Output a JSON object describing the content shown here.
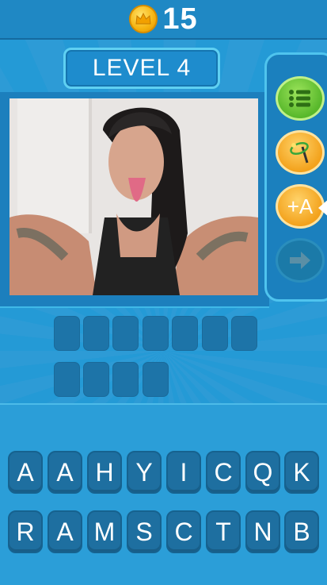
{
  "header": {
    "coins": "15",
    "coin_icon": "crown-coin-icon"
  },
  "level": {
    "label": "LEVEL 4"
  },
  "puzzle": {
    "answer_rows": [
      7,
      4
    ]
  },
  "powerups": {
    "plus_letter_label": "+A",
    "icons": [
      "menu-list-icon",
      "magic-wand-icon",
      "add-letter-icon",
      "next-arrow-icon"
    ]
  },
  "keyboard": {
    "row1": [
      "A",
      "A",
      "H",
      "Y",
      "I",
      "C",
      "Q",
      "K"
    ],
    "row2": [
      "R",
      "A",
      "M",
      "S",
      "C",
      "T",
      "N",
      "B"
    ]
  },
  "colors": {
    "accent": "#2a9ad6",
    "green_button": "#58b82b",
    "orange_button": "#f3a21c"
  }
}
